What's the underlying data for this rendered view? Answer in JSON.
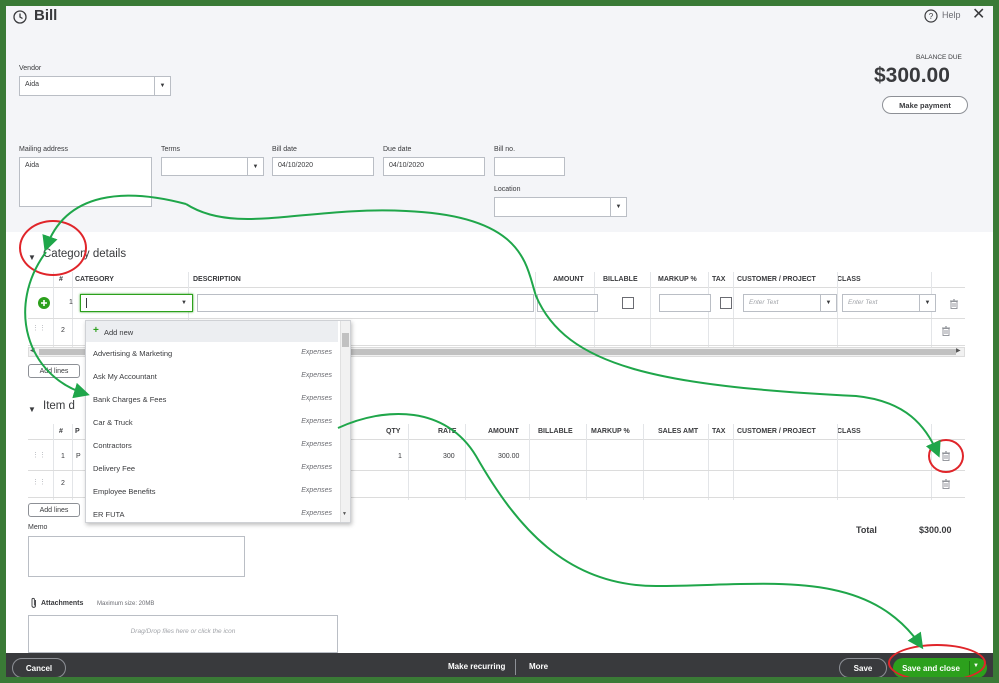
{
  "header": {
    "title": "Bill",
    "help_label": "Help",
    "close_glyph": "✕",
    "balance_label": "BALANCE DUE",
    "balance_value": "$300.00",
    "make_payment_label": "Make payment"
  },
  "form": {
    "vendor_label": "Vendor",
    "vendor_value": "Aida",
    "mailing_label": "Mailing address",
    "mailing_value": "Aida",
    "terms_label": "Terms",
    "terms_value": "",
    "bill_date_label": "Bill date",
    "bill_date_value": "04/10/2020",
    "due_date_label": "Due date",
    "due_date_value": "04/10/2020",
    "bill_no_label": "Bill no.",
    "bill_no_value": "",
    "location_label": "Location",
    "location_value": ""
  },
  "category": {
    "title": "Category details",
    "columns": [
      "#",
      "CATEGORY",
      "DESCRIPTION",
      "AMOUNT",
      "BILLABLE",
      "MARKUP %",
      "TAX",
      "CUSTOMER / PROJECT",
      "CLASS"
    ],
    "row_numbers": [
      "1",
      "2"
    ],
    "enter_text_placeholder": "Enter Text",
    "add_lines_label": "Add lines"
  },
  "dropdown": {
    "add_new_label": "Add new",
    "items": [
      {
        "name": "Advertising & Marketing",
        "type": "Expenses"
      },
      {
        "name": "Ask My Accountant",
        "type": "Expenses"
      },
      {
        "name": "Bank Charges & Fees",
        "type": "Expenses"
      },
      {
        "name": "Car & Truck",
        "type": "Expenses"
      },
      {
        "name": "Contractors",
        "type": "Expenses"
      },
      {
        "name": "Delivery Fee",
        "type": "Expenses"
      },
      {
        "name": "Employee Benefits",
        "type": "Expenses"
      },
      {
        "name": "ER FUTA",
        "type": "Expenses"
      }
    ]
  },
  "item": {
    "title_visible": "Item d",
    "columns": [
      "#",
      "P",
      "QTY",
      "RATE",
      "AMOUNT",
      "BILLABLE",
      "MARKUP %",
      "SALES AMT",
      "TAX",
      "CUSTOMER / PROJECT",
      "CLASS"
    ],
    "rows": [
      {
        "num": "1",
        "product": "P",
        "qty": "1",
        "rate": "300",
        "amount": "300.00"
      },
      {
        "num": "2",
        "product": "",
        "qty": "",
        "rate": "",
        "amount": ""
      }
    ],
    "add_lines_label": "Add lines"
  },
  "totals": {
    "total_label": "Total",
    "total_value": "$300.00"
  },
  "memo": {
    "label": "Memo",
    "value": ""
  },
  "attachments": {
    "label": "Attachments",
    "max_size": "Maximum size: 20MB",
    "drop_text": "Drag/Drop files here or click the icon"
  },
  "footer": {
    "cancel_label": "Cancel",
    "make_recurring_label": "Make recurring",
    "more_label": "More",
    "save_label": "Save",
    "save_close_label": "Save and close"
  },
  "colors": {
    "green_primary": "#2ca01c",
    "border_frame": "#3a7a36",
    "annotation_red": "#e0252a",
    "annotation_green": "#1fa64a",
    "footer_bg": "#393a3d"
  }
}
